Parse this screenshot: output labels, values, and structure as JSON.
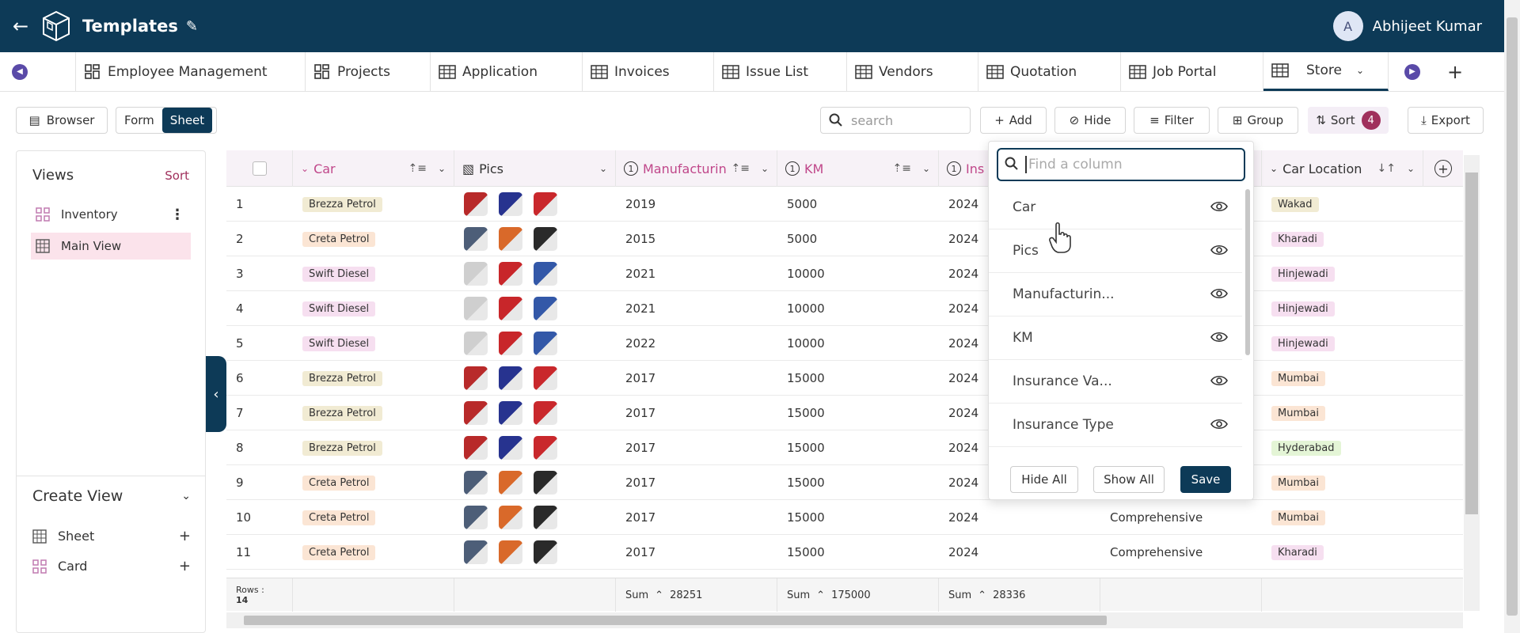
{
  "header": {
    "title": "Templates",
    "user_initial": "A",
    "user_name": "Abhijeet Kumar"
  },
  "tabs": [
    {
      "label": "Employee Management",
      "icon": "dashboard-icon"
    },
    {
      "label": "Projects",
      "icon": "dashboard-icon"
    },
    {
      "label": "Application",
      "icon": "table-icon"
    },
    {
      "label": "Invoices",
      "icon": "table-icon"
    },
    {
      "label": "Issue List",
      "icon": "table-icon"
    },
    {
      "label": "Vendors",
      "icon": "table-icon"
    },
    {
      "label": "Quotation",
      "icon": "table-icon"
    },
    {
      "label": "Job Portal",
      "icon": "table-icon"
    },
    {
      "label": "Store",
      "icon": "table-icon",
      "active": true
    }
  ],
  "toolbar": {
    "browser": "Browser",
    "form": "Form",
    "sheet": "Sheet",
    "search_placeholder": "search",
    "add": "Add",
    "hide": "Hide",
    "filter": "Filter",
    "group": "Group",
    "sort": "Sort",
    "sort_count": "4",
    "export": "Export"
  },
  "sidebar": {
    "views_title": "Views",
    "sort_label": "Sort",
    "views": [
      {
        "label": "Inventory",
        "icon": "card-icon"
      },
      {
        "label": "Main View",
        "icon": "sheet-icon",
        "active": true
      }
    ],
    "create_title": "Create View",
    "create_items": [
      {
        "label": "Sheet",
        "icon": "sheet-icon"
      },
      {
        "label": "Card",
        "icon": "card-icon"
      }
    ]
  },
  "grid": {
    "columns": [
      {
        "label": "Car"
      },
      {
        "label": "Pics"
      },
      {
        "label": "Manufacturin",
        "num": "1"
      },
      {
        "label": "KM",
        "num": "1"
      },
      {
        "label": "Ins",
        "num": "1"
      },
      {
        "label": ""
      },
      {
        "label": "Car Location"
      }
    ],
    "rows": [
      {
        "n": "1",
        "car": "Brezza Petrol",
        "mfg": "2019",
        "km": "5000",
        "ins": "2024",
        "type": "",
        "loc": "Wakad"
      },
      {
        "n": "2",
        "car": "Creta Petrol",
        "mfg": "2015",
        "km": "5000",
        "ins": "2024",
        "type": "",
        "loc": "Kharadi"
      },
      {
        "n": "3",
        "car": "Swift Diesel",
        "mfg": "2021",
        "km": "10000",
        "ins": "2024",
        "type": "",
        "loc": "Hinjewadi"
      },
      {
        "n": "4",
        "car": "Swift Diesel",
        "mfg": "2021",
        "km": "10000",
        "ins": "2024",
        "type": "",
        "loc": "Hinjewadi"
      },
      {
        "n": "5",
        "car": "Swift Diesel",
        "mfg": "2022",
        "km": "10000",
        "ins": "2024",
        "type": "",
        "loc": "Hinjewadi"
      },
      {
        "n": "6",
        "car": "Brezza Petrol",
        "mfg": "2017",
        "km": "15000",
        "ins": "2024",
        "type": "",
        "loc": "Mumbai"
      },
      {
        "n": "7",
        "car": "Brezza Petrol",
        "mfg": "2017",
        "km": "15000",
        "ins": "2024",
        "type": "",
        "loc": "Mumbai"
      },
      {
        "n": "8",
        "car": "Brezza Petrol",
        "mfg": "2017",
        "km": "15000",
        "ins": "2024",
        "type": "",
        "loc": "Hyderabad"
      },
      {
        "n": "9",
        "car": "Creta Petrol",
        "mfg": "2017",
        "km": "15000",
        "ins": "2024",
        "type": "",
        "loc": "Mumbai"
      },
      {
        "n": "10",
        "car": "Creta Petrol",
        "mfg": "2017",
        "km": "15000",
        "ins": "2024",
        "type": "Comprehensive",
        "loc": "Mumbai"
      },
      {
        "n": "11",
        "car": "Creta Petrol",
        "mfg": "2017",
        "km": "15000",
        "ins": "2024",
        "type": "Comprehensive",
        "loc": "Kharadi"
      }
    ],
    "footer": {
      "rows_label": "Rows :",
      "rows_count": "14",
      "sum_label": "Sum",
      "sum_mfg": "28251",
      "sum_km": "175000",
      "sum_ins": "28336"
    }
  },
  "column_popover": {
    "search_placeholder": "Find a column",
    "items": [
      "Car",
      "Pics",
      "Manufacturin...",
      "KM",
      "Insurance Va...",
      "Insurance Type"
    ],
    "hide_all": "Hide All",
    "show_all": "Show All",
    "save": "Save"
  },
  "colors": {
    "brand": "#0d3a57",
    "accent": "#a0305c",
    "pill_brezza": "#f1ebd3",
    "pill_creta": "#fbe5d4",
    "pill_swift": "#f6dff0",
    "pill_wakad": "#f1ebd3",
    "pill_kharadi": "#f6dff0",
    "pill_hinjewadi": "#f6dff0",
    "pill_mumbai": "#fbe5d4",
    "pill_hyderabad": "#e4f5d6"
  }
}
